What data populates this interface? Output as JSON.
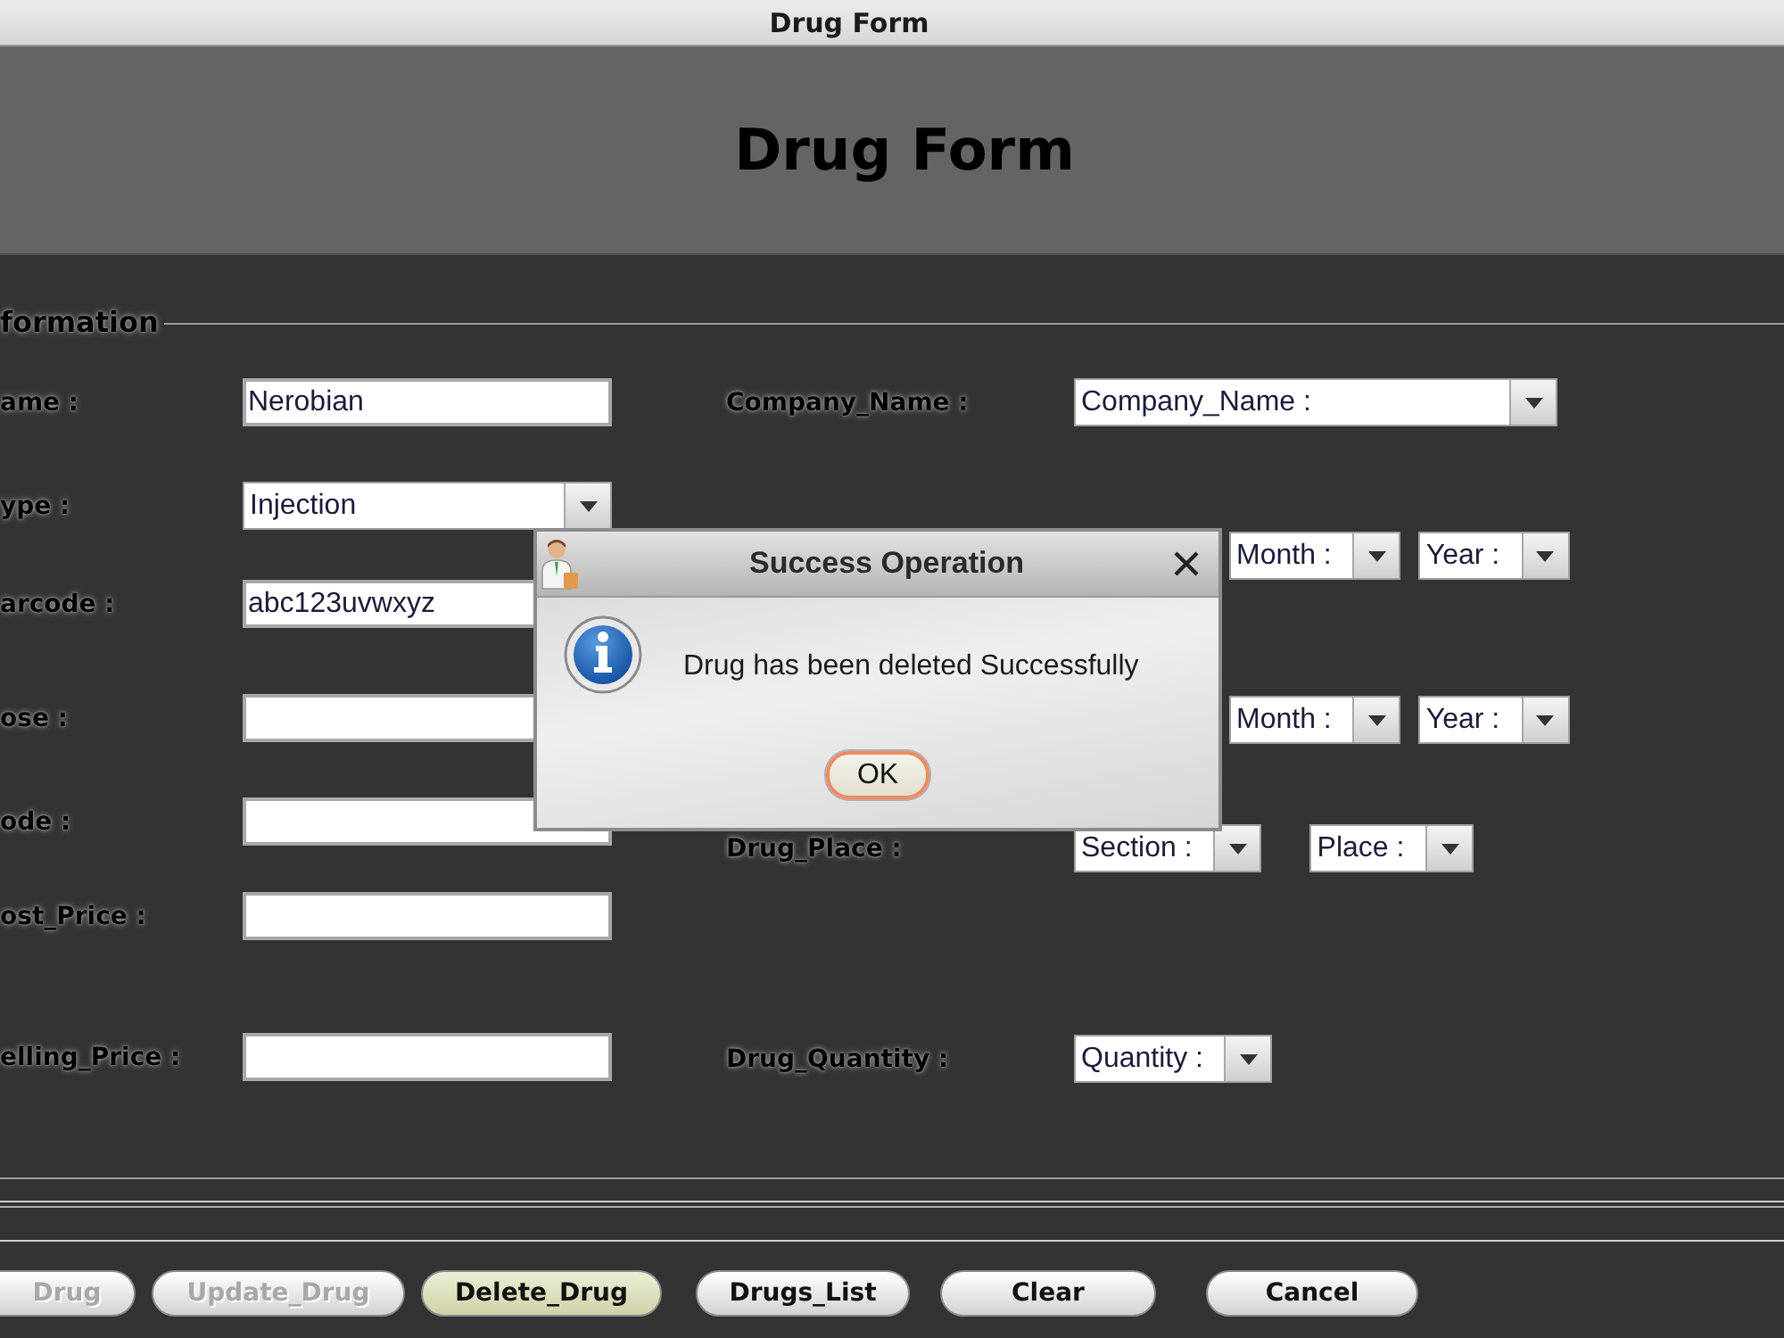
{
  "window": {
    "title": "Drug Form"
  },
  "header": {
    "title": "Drug Form"
  },
  "section": {
    "title": "formation"
  },
  "left_fields": [
    {
      "label": "ame :",
      "kind": "text",
      "value": "Nerobian"
    },
    {
      "label": "ype :",
      "kind": "combo",
      "value": "Injection"
    },
    {
      "label": "arcode :",
      "kind": "text",
      "value": "abc123uvwxyz"
    },
    {
      "label": "ose :",
      "kind": "text"
    },
    {
      "label": "ode :",
      "kind": "text"
    },
    {
      "label": "ost_Price :",
      "kind": "text"
    },
    {
      "label": "elling_Price :",
      "kind": "text"
    }
  ],
  "right_fields": [
    {
      "label": "Company_Name :",
      "combos": [
        {
          "value": "Company_Name :"
        }
      ]
    },
    {
      "combos": [
        {
          "value": "Month :"
        },
        {
          "value": "Year :"
        }
      ]
    },
    {
      "combos": [
        {
          "value": "Month :"
        },
        {
          "value": "Year :"
        }
      ]
    },
    {
      "label": "Drug_Place :",
      "combos": [
        {
          "value": "Section :"
        },
        {
          "value": "Place :"
        }
      ]
    },
    {
      "label": "Drug_Quantity :",
      "combos": [
        {
          "value": "Quantity :"
        }
      ]
    }
  ],
  "buttons": [
    {
      "label": "Drug",
      "disabled": true,
      "highlighted": false
    },
    {
      "label": "Update_Drug",
      "disabled": true,
      "highlighted": false
    },
    {
      "label": "Delete_Drug",
      "disabled": false,
      "highlighted": true
    },
    {
      "label": "Drugs_List",
      "disabled": false,
      "highlighted": false
    },
    {
      "label": "Clear",
      "disabled": false,
      "highlighted": false
    },
    {
      "label": "Cancel",
      "disabled": false,
      "highlighted": false
    }
  ],
  "dialog": {
    "title": "Success Operation",
    "message": "Drug has been deleted Successfully",
    "ok_button": {
      "label": "OK",
      "focused": true
    }
  }
}
